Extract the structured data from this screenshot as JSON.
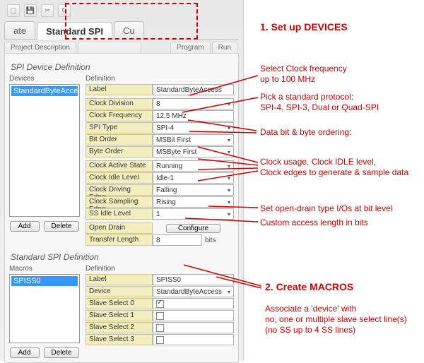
{
  "toolbar_icons": [
    "open",
    "save",
    "cut",
    "refresh"
  ],
  "tabs": {
    "left_partial": "ate",
    "active": "Standard SPI",
    "right_partial": "Cu"
  },
  "subtabs": [
    "Project Description",
    "",
    "Program",
    "Run"
  ],
  "device_group": {
    "title": "SPI Device Definition",
    "devices_label": "Devices",
    "definition_label": "Definition",
    "selected_device": "StandardByteAccess",
    "add_label": "Add",
    "delete_label": "Delete",
    "rows": [
      {
        "label": "Label",
        "value": "StandardByteAccess",
        "dropdown": false
      },
      {
        "label": "Clock Division",
        "value": "8",
        "dropdown": true
      },
      {
        "label": "Clock Frequency",
        "value": "12.5 MHz",
        "dropdown": false
      },
      {
        "label": "SPI Type",
        "value": "SPI-4",
        "dropdown": true
      },
      {
        "label": "Bit Order",
        "value": "MSBit First",
        "dropdown": true
      },
      {
        "label": "Byte Order",
        "value": "MSByte First",
        "dropdown": true
      },
      {
        "label": "Clock Active State",
        "value": "Running",
        "dropdown": true
      },
      {
        "label": "Clock Idle Level",
        "value": "Idle-1",
        "dropdown": true
      },
      {
        "label": "Clock Driving Edge",
        "value": "Falling",
        "dropdown": true
      },
      {
        "label": "Clock Sampling Edge",
        "value": "Rising",
        "dropdown": true
      },
      {
        "label": "SS Idle Level",
        "value": "1",
        "dropdown": true
      }
    ],
    "open_drain_label": "Open Drain",
    "configure_label": "Configure",
    "transfer_length_label": "Transfer Length",
    "transfer_length_value": "8",
    "transfer_length_unit": "bits"
  },
  "macro_group": {
    "title": "Standard SPI Definition",
    "macros_label": "Macros",
    "definition_label": "Definition",
    "selected_macro": "SPISS0",
    "add_label": "Add",
    "delete_label": "Delete",
    "label_row": {
      "label": "Label",
      "value": "SPISS0"
    },
    "device_row": {
      "label": "Device",
      "value": "StandardByteAccess"
    },
    "ss_rows": [
      {
        "label": "Slave Select 0",
        "checked": true
      },
      {
        "label": "Slave Select 1",
        "checked": false
      },
      {
        "label": "Slave Select 2",
        "checked": false
      },
      {
        "label": "Slave Select 3",
        "checked": false
      }
    ]
  },
  "annotations": {
    "h1": "1. Set up DEVICES",
    "clock_freq": "Select Clock frequency\nup to 100 MHz",
    "protocol": "Pick a standard protocol:\nSPI-4, SPI-3, Dual or Quad-SPI",
    "ordering": "Data bit & byte ordering:",
    "clock_usage": "Clock usage, Clock IDLE level,\nClock edges to generate & sample data",
    "open_drain": "Set open-drain type I/Os at bit level",
    "access_len": "Custom access length in bits",
    "h2": "2. Create MACROS",
    "assoc": "Associate a 'device' with\nno, one or multiple slave select line(s)\n(no SS up to 4 SS lines)"
  }
}
